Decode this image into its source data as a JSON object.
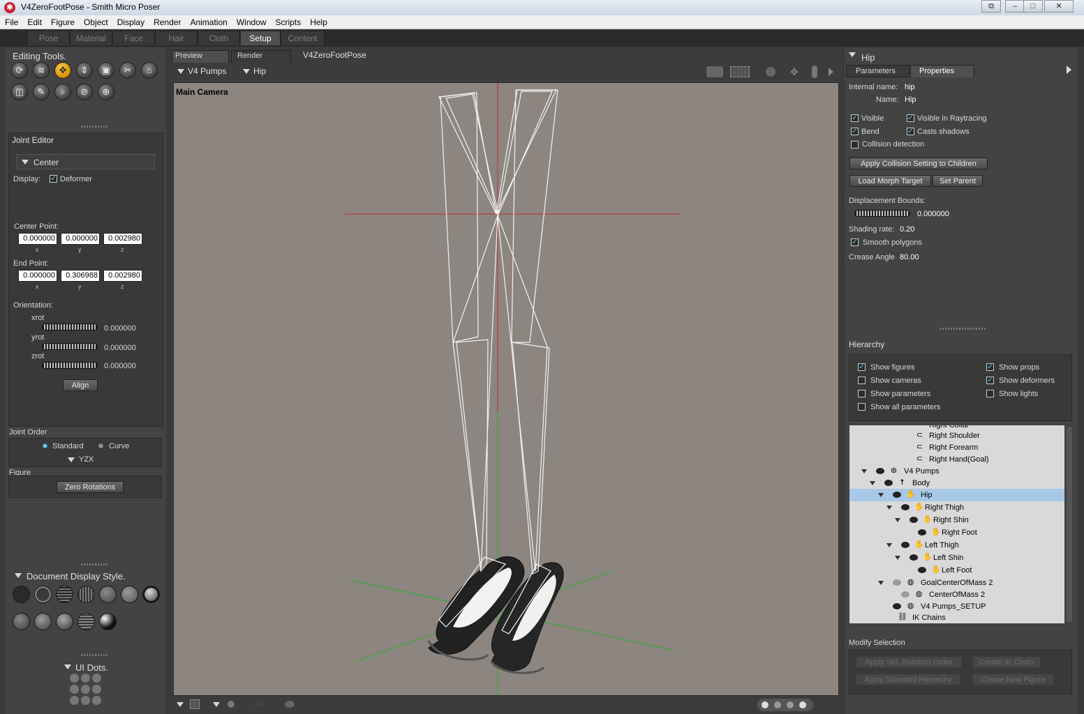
{
  "window": {
    "title": "V4ZeroFootPose - Smith Micro Poser"
  },
  "menu": [
    "File",
    "Edit",
    "Figure",
    "Object",
    "Display",
    "Render",
    "Animation",
    "Window",
    "Scripts",
    "Help"
  ],
  "rooms": [
    "Pose",
    "Material",
    "Face",
    "Hair",
    "Cloth",
    "Setup",
    "Content"
  ],
  "active_room": "Setup",
  "editing_tools": {
    "title": "Editing Tools."
  },
  "joint_editor": {
    "title": "Joint Editor",
    "dropdown": "Center",
    "display_label": "Display:",
    "deformer_label": "Deformer",
    "center_point_label": "Center Point:",
    "center_point": {
      "x": "0.000000",
      "y": "0.000000",
      "z": "0.002980"
    },
    "end_point_label": "End Point:",
    "end_point": {
      "x": "0.000000",
      "y": "0.306988",
      "z": "0.002980"
    },
    "axis": {
      "x": "x",
      "y": "y",
      "z": "z"
    },
    "orientation_label": "Orientation:",
    "xrot_label": "xrot",
    "xrot": "0.000000",
    "yrot_label": "yrot",
    "yrot": "0.000000",
    "zrot_label": "zrot",
    "zrot": "0.000000",
    "align_button": "Align"
  },
  "joint_order": {
    "title": "Joint Order",
    "standard_label": "Standard",
    "curve_label": "Curve",
    "order": "YZX"
  },
  "figure_section": {
    "title": "Figure",
    "zero_rotations_button": "Zero Rotations"
  },
  "document_display_style": {
    "title": "Document Display Style."
  },
  "ui_dots": {
    "title": "UI Dots."
  },
  "document": {
    "tabs": [
      "Preview",
      "Render"
    ],
    "doc_name": "V4ZeroFootPose",
    "figure_select": "V4 Pumps",
    "actor_select": "Hip",
    "camera_label": "Main Camera"
  },
  "properties_panel": {
    "actor": "Hip",
    "tabs": [
      "Parameters",
      "Properties"
    ],
    "internal_name_label": "Internal name:",
    "internal_name": "hip",
    "name_label": "Name:",
    "name": "Hip",
    "visible_label": "Visible",
    "visible_raytracing_label": "Visible in Raytracing",
    "bend_label": "Bend",
    "casts_shadows_label": "Casts shadows",
    "collision_label": "Collision detection",
    "apply_collision_button": "Apply Collision Setting to Children",
    "load_morph_button": "Load Morph Target",
    "set_parent_button": "Set Parent",
    "displacement_label": "Displacement Bounds:",
    "displacement_value": "0.000000",
    "shading_rate_label": "Shading rate:",
    "shading_rate": "0.20",
    "smooth_polygons_label": "Smooth polygons",
    "crease_angle_label": "Crease Angle",
    "crease_angle": "80.00"
  },
  "hierarchy": {
    "title": "Hierarchy",
    "options": {
      "show_figures": "Show figures",
      "show_props": "Show props",
      "show_cameras": "Show cameras",
      "show_deformers": "Show deformers",
      "show_parameters": "Show parameters",
      "show_lights": "Show lights",
      "show_all_parameters": "Show all parameters"
    },
    "rows": [
      "Right Collar",
      "Right Shoulder",
      "Right Forearm",
      "Right Hand(Goal)",
      "V4 Pumps",
      "Body",
      "Hip",
      "Right Thigh",
      "Right Shin",
      "Right Foot",
      "Left Thigh",
      "Left Shin",
      "Left Foot",
      "GoalCenterOfMass 2",
      "CenterOfMass 2",
      "V4 Pumps_SETUP",
      "IK Chains"
    ]
  },
  "modify_selection": {
    "title": "Modify Selection",
    "buttons": [
      "Apply Std. Rotation Order",
      "Create IK Chain",
      "Apply Standard Hierarchy",
      "Create New Figure"
    ]
  }
}
